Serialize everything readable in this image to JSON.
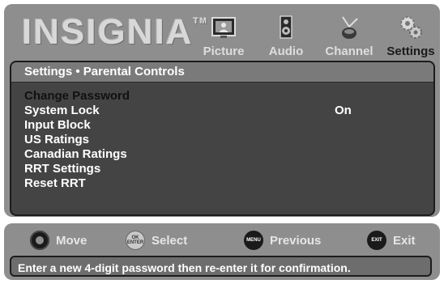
{
  "brand": {
    "name": "INSIGNIA",
    "trademark": "TM"
  },
  "tabs": [
    {
      "label": "Picture",
      "icon": "picture-icon",
      "active": false
    },
    {
      "label": "Audio",
      "icon": "speaker-icon",
      "active": false
    },
    {
      "label": "Channel",
      "icon": "antenna-icon",
      "active": false
    },
    {
      "label": "Settings",
      "icon": "gears-icon",
      "active": true
    }
  ],
  "content": {
    "header": "Settings • Parental Controls",
    "items": [
      {
        "label": "Change Password",
        "value": "",
        "selected": true
      },
      {
        "label": "System Lock",
        "value": "On",
        "selected": false
      },
      {
        "label": "Input Block",
        "value": "",
        "selected": false
      },
      {
        "label": "US Ratings",
        "value": "",
        "selected": false
      },
      {
        "label": "Canadian Ratings",
        "value": "",
        "selected": false
      },
      {
        "label": "RRT Settings",
        "value": "",
        "selected": false
      },
      {
        "label": "Reset RRT",
        "value": "",
        "selected": false
      }
    ]
  },
  "hints": {
    "move": {
      "label": "Move",
      "icon": "dpad-icon"
    },
    "select": {
      "label": "Select",
      "icon": "ok-enter-icon",
      "icon_text": [
        "OK",
        "ENTER"
      ]
    },
    "previous": {
      "label": "Previous",
      "icon": "menu-button-icon",
      "icon_text": "MENU"
    },
    "exit": {
      "label": "Exit",
      "icon": "exit-button-icon",
      "icon_text": "EXIT"
    }
  },
  "message": "Enter a new 4-digit password then re-enter it for confirmation.",
  "colors": {
    "panel": "#8e8e8e",
    "content_bg": "#444444",
    "header_bg": "#7a7a7a",
    "selected_text": "#111111",
    "text": "#ffffff"
  }
}
